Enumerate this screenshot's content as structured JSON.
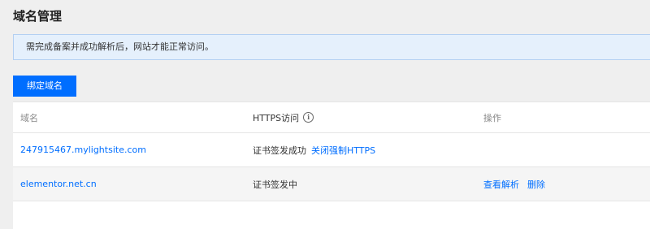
{
  "page": {
    "title": "域名管理"
  },
  "notice": {
    "text": "需完成备案并成功解析后，网站才能正常访问。"
  },
  "toolbar": {
    "bind_label": "绑定域名"
  },
  "table": {
    "headers": {
      "domain": "域名",
      "https": "HTTPS访问",
      "actions": "操作"
    },
    "rows": [
      {
        "domain": "247915467.mylightsite.com",
        "status": "证书签发成功",
        "https_action": "关闭强制HTTPS",
        "actions": []
      },
      {
        "domain": "elementor.net.cn",
        "status": "证书签发中",
        "https_action": "",
        "actions": [
          "查看解析",
          "删除"
        ]
      }
    ]
  },
  "icons": {
    "https_info": "info-icon"
  },
  "colors": {
    "accent": "#006eff",
    "notice_bg": "#e5f0fc",
    "notice_border": "#b4d0f2"
  }
}
